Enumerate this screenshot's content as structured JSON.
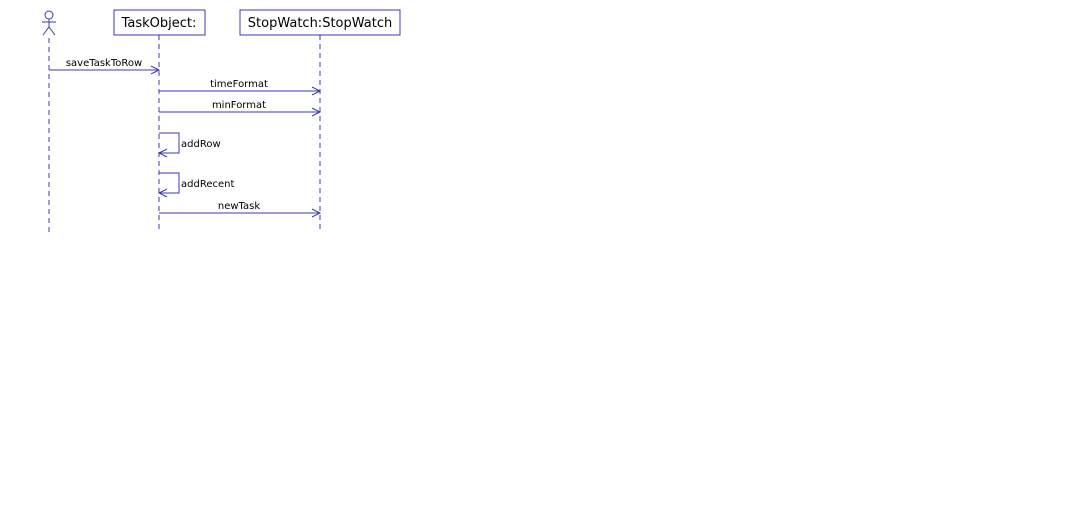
{
  "diagram": {
    "type": "uml-sequence",
    "colors": {
      "line": "#3b3bb3",
      "text": "#000000",
      "background": "#ffffff"
    },
    "participants": [
      {
        "id": "actor",
        "kind": "actor",
        "label": ""
      },
      {
        "id": "task",
        "kind": "object",
        "label": "TaskObject:"
      },
      {
        "id": "stopwatch",
        "kind": "object",
        "label": "StopWatch:StopWatch"
      }
    ],
    "messages": [
      {
        "from": "actor",
        "to": "task",
        "label": "saveTaskToRow",
        "self": false
      },
      {
        "from": "task",
        "to": "stopwatch",
        "label": "timeFormat",
        "self": false
      },
      {
        "from": "task",
        "to": "stopwatch",
        "label": "minFormat",
        "self": false
      },
      {
        "from": "task",
        "to": "task",
        "label": "addRow",
        "self": true
      },
      {
        "from": "task",
        "to": "task",
        "label": "addRecent",
        "self": true
      },
      {
        "from": "task",
        "to": "stopwatch",
        "label": "newTask",
        "self": false
      }
    ]
  }
}
